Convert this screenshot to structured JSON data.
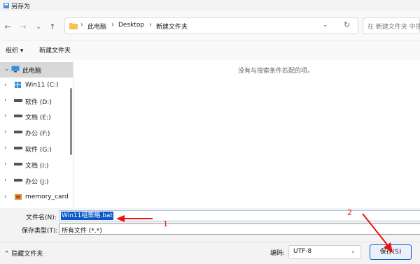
{
  "window": {
    "title": "另存为"
  },
  "nav": {
    "back_icon": "←",
    "forward_icon": "→",
    "recent_icon": "⌄",
    "up_icon": "↑",
    "breadcrumbs": [
      "此电脑",
      "Desktop",
      "新建文件夹"
    ],
    "dropdown_icon": "⌄",
    "refresh_icon": "↻",
    "search_placeholder": "在 新建文件夹 中搜"
  },
  "toolbar": {
    "organize": "组织 ▾",
    "new_folder": "新建文件夹"
  },
  "sidebar": {
    "items": [
      {
        "label": "此电脑",
        "icon": "computer-icon",
        "selected": true
      },
      {
        "label": "Win11 (C:)",
        "icon": "windows-drive-icon"
      },
      {
        "label": "软件 (D:)",
        "icon": "drive-icon"
      },
      {
        "label": "文档 (E:)",
        "icon": "drive-icon"
      },
      {
        "label": "办公 (F:)",
        "icon": "drive-icon"
      },
      {
        "label": "软件 (G:)",
        "icon": "drive-icon"
      },
      {
        "label": "文档 (I:)",
        "icon": "drive-icon"
      },
      {
        "label": "办公 (J:)",
        "icon": "drive-icon"
      },
      {
        "label": "memory_card",
        "icon": "card-icon"
      }
    ]
  },
  "content": {
    "empty_text": "没有与搜索条件匹配的项。"
  },
  "form": {
    "filename_label": "文件名(N):",
    "filename_value": "Win11组策略.bat",
    "filetype_label": "保存类型(T):",
    "filetype_value": "所有文件  (*.*)"
  },
  "footer": {
    "hide_folders": "隐藏文件夹",
    "encoding_label": "编码:",
    "encoding_value": "UTF-8",
    "save_button": "保存(S)"
  },
  "annotations": {
    "one": "1",
    "two": "2"
  },
  "colors": {
    "accent": "#0b57c9",
    "annotation": "#e11111"
  }
}
